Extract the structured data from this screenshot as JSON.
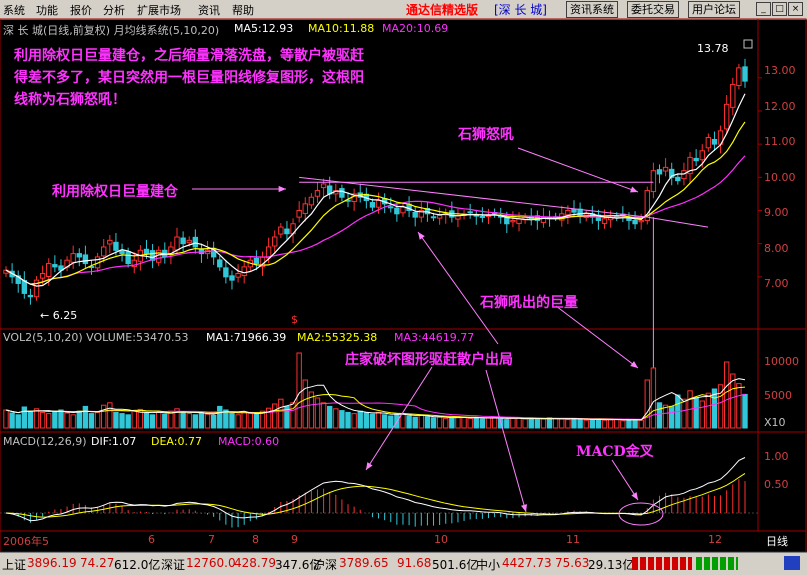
{
  "menu": {
    "items": [
      "系统",
      "功能",
      "报价",
      "分析",
      "扩展市场",
      "资讯",
      "帮助"
    ],
    "brand": "通达信精选版",
    "stock_name": "[深 长 城]",
    "buttons": [
      "资讯系统",
      "委托交易",
      "用户论坛"
    ],
    "window_buttons": [
      "_",
      "□",
      "×"
    ]
  },
  "price_header": {
    "title": "深 长 城(日线,前复权) 月均线系统(5,10,20)",
    "ma5": "MA5:12.93",
    "ma10": "MA10:11.88",
    "ma20": "MA20:10.69"
  },
  "volume_header": {
    "title": "VOL2(5,10,20) VOLUME:53470.53",
    "ma1": "MA1:71966.39",
    "ma2": "MA2:55325.38",
    "ma3": "MA3:44619.77"
  },
  "macd_header": {
    "title": "MACD(12,26,9)",
    "dif": "DIF:1.07",
    "dea": "DEA:0.77",
    "macd": "MACD:0.60"
  },
  "annotations": {
    "intro": "利用除权日巨量建仓，之后缩量滑落洗盘，等散户被驱赶得差不多了，某日突然用一根巨量阳线修复图形，这根阳线称为石狮怒吼！",
    "roar": "石狮怒吼",
    "build": "利用除权日巨量建仓",
    "roar_volume": "石狮吼出的巨量",
    "shakeout": "庄家破坏图形驱赶散户出局",
    "golden_cross": "MACD金叉"
  },
  "price_labels": {
    "high": "13.78",
    "low": "← 6.25",
    "marker": "$"
  },
  "price_axis": [
    "13.00",
    "12.00",
    "11.00",
    "10.00",
    "9.00",
    "8.00",
    "7.00"
  ],
  "volume_axis": [
    "10000",
    "5000",
    "X10"
  ],
  "macd_axis": [
    "1.00",
    "0.50"
  ],
  "x_axis": {
    "labels": [
      "2006年5",
      "6",
      "7",
      "8",
      "9",
      "10",
      "11",
      "12"
    ],
    "period": "日线"
  },
  "colors": {
    "up": "#ff3030",
    "down": "#30c8d8",
    "ma5": "#ffffff",
    "ma10": "#ffff00",
    "ma20": "#ff30ff",
    "annotation": "#ff33ff",
    "axis": "#c00000"
  },
  "status_bar": {
    "sh": {
      "name": "上证",
      "index": "3896.19",
      "change": "74.27",
      "amount": "612.0亿"
    },
    "sz": {
      "name": "深证",
      "index": "12760.0",
      "change": "428.79",
      "amount": "347.6亿"
    },
    "hs": {
      "name": "沪深",
      "index": "3789.65",
      "change": "91.68",
      "amount": "501.6亿"
    },
    "zx": {
      "name": "中小",
      "index": "4427.73",
      "change": "75.63",
      "amount": "29.13亿"
    }
  },
  "chart_data": {
    "type": "candlestick",
    "title": "深 长 城(日线,前复权)",
    "x_months": [
      "2006年5",
      "6",
      "7",
      "8",
      "9",
      "10",
      "11",
      "12"
    ],
    "close": [
      7.2,
      7.0,
      6.8,
      6.5,
      6.4,
      6.9,
      7.1,
      7.4,
      7.3,
      7.2,
      7.5,
      7.7,
      7.6,
      7.4,
      7.3,
      7.6,
      7.9,
      8.1,
      7.8,
      7.7,
      7.4,
      7.5,
      7.8,
      7.7,
      7.5,
      7.8,
      7.6,
      7.9,
      8.2,
      8.0,
      8.1,
      7.9,
      7.7,
      7.8,
      7.6,
      7.3,
      7.0,
      6.9,
      7.1,
      7.3,
      7.5,
      7.4,
      7.6,
      7.9,
      8.2,
      8.5,
      8.3,
      8.6,
      9.0,
      9.2,
      9.4,
      9.6,
      9.8,
      9.5,
      9.6,
      9.4,
      9.3,
      9.5,
      9.4,
      9.3,
      9.1,
      9.3,
      9.2,
      9.1,
      8.9,
      9.1,
      9.0,
      8.8,
      9.0,
      8.9,
      8.8,
      8.85,
      8.9,
      8.8,
      8.85,
      8.9,
      8.95,
      8.85,
      8.8,
      8.85,
      8.9,
      8.8,
      8.6,
      8.7,
      8.75,
      8.8,
      8.75,
      8.7,
      8.8,
      8.75,
      8.8,
      8.9,
      9.0,
      8.95,
      8.85,
      8.9,
      8.8,
      8.7,
      8.75,
      8.8,
      8.8,
      8.85,
      8.7,
      8.6,
      8.7,
      9.6,
      10.2,
      10.1,
      10.3,
      10.0,
      9.9,
      10.2,
      10.6,
      10.5,
      10.8,
      11.2,
      11.0,
      11.4,
      12.2,
      12.8,
      13.3,
      12.9
    ],
    "volume_k": [
      3000,
      2500,
      2200,
      3500,
      2800,
      3200,
      2600,
      2400,
      2800,
      3000,
      2500,
      2200,
      2800,
      3600,
      2400,
      2600,
      3800,
      4200,
      2600,
      2400,
      2200,
      2800,
      3100,
      2500,
      2200,
      2600,
      2300,
      2800,
      3200,
      2500,
      2400,
      2200,
      2600,
      2300,
      2100,
      3600,
      3000,
      2500,
      2200,
      2600,
      2400,
      2300,
      2800,
      3300,
      4000,
      4800,
      3600,
      4200,
      12500,
      8000,
      6000,
      5000,
      4200,
      3600,
      3200,
      2900,
      2600,
      2400,
      2800,
      2500,
      2300,
      2600,
      2200,
      2000,
      2300,
      2400,
      2000,
      1800,
      2100,
      1900,
      1700,
      1800,
      1600,
      1700,
      1900,
      1800,
      1600,
      1700,
      1500,
      1700,
      1800,
      1600,
      1400,
      1600,
      1700,
      1500,
      1600,
      1400,
      1500,
      1700,
      1600,
      1500,
      1400,
      1600,
      1500,
      1300,
      1400,
      1500,
      1300,
      1400,
      1500,
      1200,
      1300,
      1400,
      1300,
      8000,
      10000,
      4200,
      3800,
      3600,
      5500,
      4800,
      6200,
      5000,
      4500,
      5800,
      6500,
      7200,
      11000,
      9000,
      7400,
      5600
    ],
    "macd": {
      "dif": 1.07,
      "dea": 0.77,
      "macd": 0.6
    },
    "ylim": [
      6.0,
      14.2
    ],
    "ma": {
      "ma5": 12.93,
      "ma10": 11.88,
      "ma20": 10.69
    }
  }
}
